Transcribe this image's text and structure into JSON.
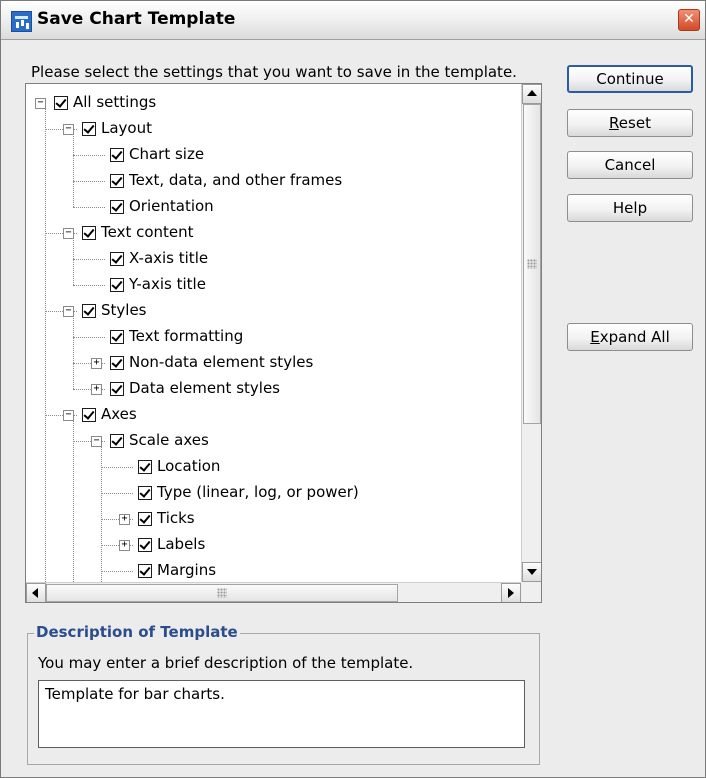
{
  "window": {
    "title": "Save Chart Template"
  },
  "instructions": "Please select the settings that you want to save in the template.",
  "tree": {
    "items": [
      {
        "label": "All settings",
        "level": 0,
        "expander": "minus"
      },
      {
        "label": "Layout",
        "level": 1,
        "expander": "minus"
      },
      {
        "label": "Chart size",
        "level": 2,
        "expander": "none"
      },
      {
        "label": "Text, data, and other frames",
        "level": 2,
        "expander": "none"
      },
      {
        "label": "Orientation",
        "level": 2,
        "expander": "none"
      },
      {
        "label": "Text content",
        "level": 1,
        "expander": "minus"
      },
      {
        "label": "X-axis title",
        "level": 2,
        "expander": "none"
      },
      {
        "label": "Y-axis title",
        "level": 2,
        "expander": "none"
      },
      {
        "label": "Styles",
        "level": 1,
        "expander": "minus"
      },
      {
        "label": "Text formatting",
        "level": 2,
        "expander": "none"
      },
      {
        "label": "Non-data element styles",
        "level": 2,
        "expander": "plus"
      },
      {
        "label": "Data element styles",
        "level": 2,
        "expander": "plus"
      },
      {
        "label": "Axes",
        "level": 1,
        "expander": "minus"
      },
      {
        "label": "Scale axes",
        "level": 2,
        "expander": "minus"
      },
      {
        "label": "Location",
        "level": 3,
        "expander": "none"
      },
      {
        "label": "Type (linear, log, or power)",
        "level": 3,
        "expander": "none"
      },
      {
        "label": "Ticks",
        "level": 3,
        "expander": "plus"
      },
      {
        "label": "Labels",
        "level": 3,
        "expander": "plus"
      },
      {
        "label": "Margins",
        "level": 3,
        "expander": "none"
      }
    ]
  },
  "buttons": {
    "continue": "Continue",
    "reset_mnemonic": "R",
    "reset_rest": "eset",
    "cancel": "Cancel",
    "help": "Help",
    "expand_all_mnemonic": "E",
    "expand_all_rest": "xpand All"
  },
  "description": {
    "group_title": "Description of Template",
    "prompt": "You may enter a brief description of the template.",
    "value": "Template for bar charts."
  },
  "icons": {
    "app": "chart-template-icon",
    "close": "close-icon",
    "tree_check": "checkbox-checked-icon"
  },
  "colors": {
    "group_title": "#2b4d8e",
    "default_button_border": "#2a5ca6",
    "close_button": "#d34a26"
  }
}
